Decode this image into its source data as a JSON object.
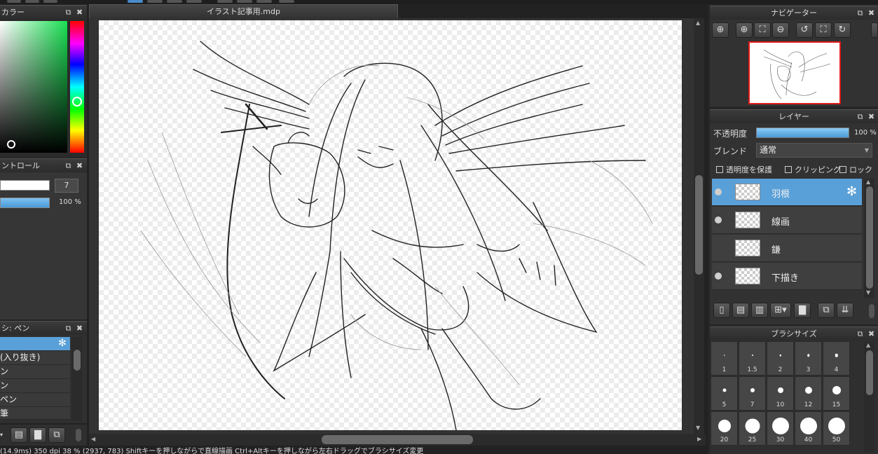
{
  "document": {
    "tab_title": "イラスト記事用.mdp"
  },
  "left": {
    "color_panel": {
      "title": "カラー"
    },
    "control_panel": {
      "title": "ントロール",
      "size_value": "7",
      "opacity_value": "100 %"
    },
    "brush_panel": {
      "title": "シ: ペン",
      "items": [
        "",
        "(入り抜き)",
        "ン",
        "ン",
        "ペン",
        "筆"
      ]
    }
  },
  "navigator": {
    "title": "ナビゲーター"
  },
  "layers": {
    "title": "レイヤー",
    "opacity_label": "不透明度",
    "opacity_value": "100 %",
    "blend_label": "ブレンド",
    "blend_value": "通常",
    "checkboxes": [
      "透明度を保護",
      "クリッピング",
      "ロック"
    ],
    "items": [
      {
        "name": "羽根",
        "selected": true,
        "visible": true
      },
      {
        "name": "線画",
        "selected": false,
        "visible": true
      },
      {
        "name": "鎌",
        "selected": false,
        "visible": false
      },
      {
        "name": "下描き",
        "selected": false,
        "visible": true
      }
    ]
  },
  "brush_size": {
    "title": "ブラシサイズ",
    "sizes": [
      "1",
      "1.5",
      "2",
      "3",
      "4",
      "5",
      "7",
      "10",
      "12",
      "15",
      "20",
      "25",
      "30",
      "40",
      "50"
    ]
  },
  "status": {
    "text": "(14.9ms) 350 dpi 38 % (2937, 783) Shiftキーを押しながらで直線描画 Ctrl+Altキーを押しながら左右ドラッグでブラシサイズ変更"
  },
  "colors": {
    "accent": "#5aa0d8",
    "panel": "#363636",
    "canvas_bg": "#333333",
    "nav_frame": "#e01b1b"
  }
}
